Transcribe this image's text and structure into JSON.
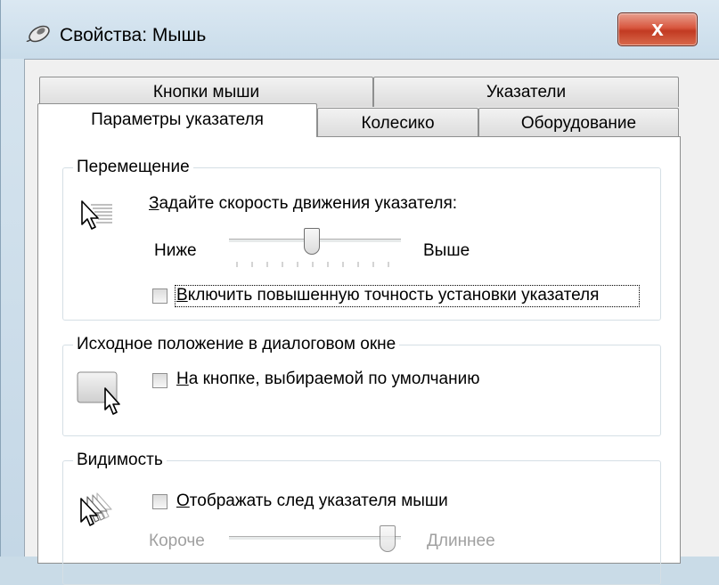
{
  "window": {
    "title": "Свойства: Мышь",
    "close_glyph": "x"
  },
  "tabs": [
    {
      "label": "Кнопки мыши",
      "active": false
    },
    {
      "label": "Указатели",
      "active": false
    },
    {
      "label": "Параметры указателя",
      "active": true
    },
    {
      "label": "Колесико",
      "active": false
    },
    {
      "label": "Оборудование",
      "active": false
    }
  ],
  "motion": {
    "title": "Перемещение",
    "speed_label_accel": "З",
    "speed_label_rest": "адайте скорость движения указателя:",
    "slow": "Ниже",
    "fast": "Выше",
    "speed_level": 0.5,
    "precision_label_accel": "В",
    "precision_label_rest": "ключить повышенную точность установки указателя",
    "precision_checked": false
  },
  "snap": {
    "title": "Исходное положение в диалоговом окне",
    "label_accel": "Н",
    "label_rest": "а кнопке, выбираемой по умолчанию",
    "checked": false
  },
  "visibility": {
    "title": "Видимость",
    "trails_label_accel": "О",
    "trails_label_rest": "тображать след указателя мыши",
    "trails_checked": false,
    "short": "Короче",
    "long": "Длиннее",
    "trail_level": 1.0
  },
  "icons": {
    "title": "mouse-icon",
    "speed": "pointer-speed-icon",
    "snap": "snap-to-button-icon",
    "trails": "pointer-trails-icon"
  },
  "colors": {
    "close": "#c23a22",
    "dim_text": "#a0a0a0"
  }
}
